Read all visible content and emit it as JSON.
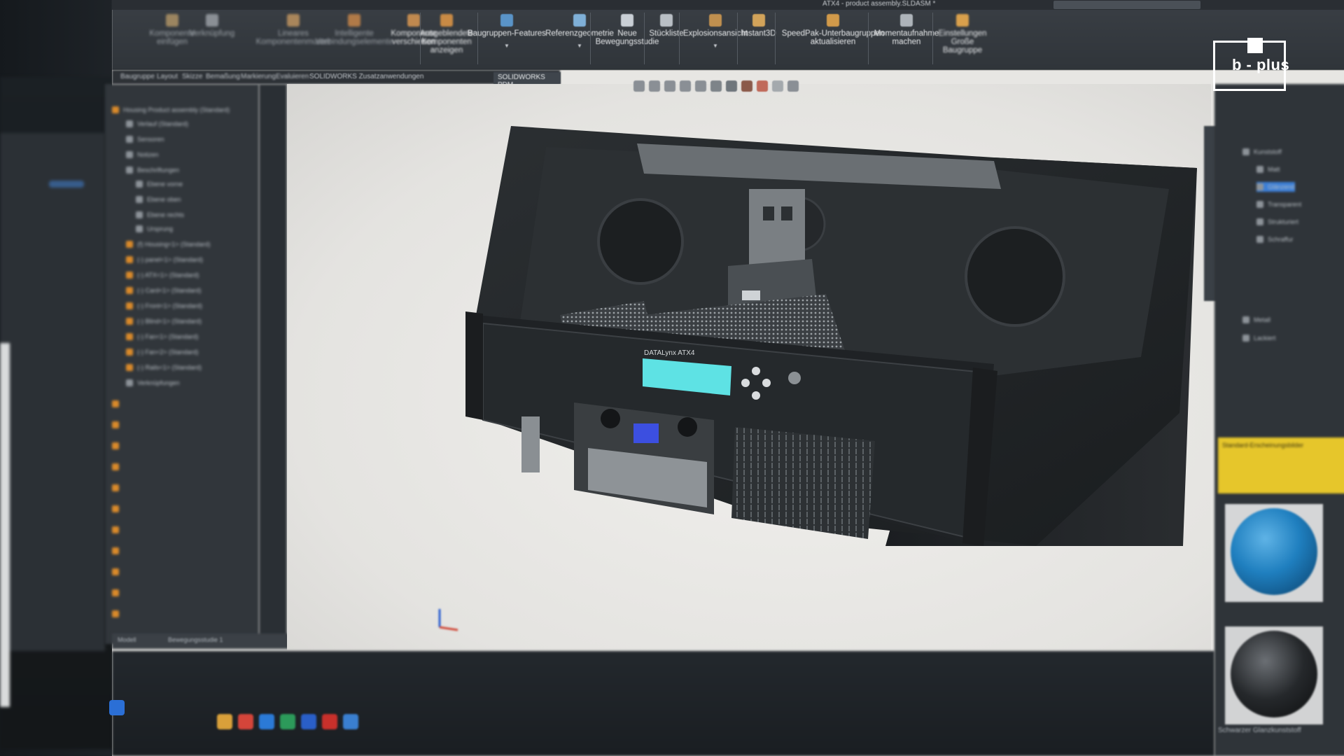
{
  "window": {
    "title": "ATX4 - product assembly.SLDASM *"
  },
  "ribbon": {
    "left_blurred_items": [
      "Komponente einfügen",
      "Verknüpfung",
      "Lineares Komponentenmuster",
      "Intelligente Verbindungselemente",
      "Komponente verschieben",
      "Ausgeblendete Komponenten anzeigen"
    ],
    "items": [
      "Baugruppen-Features",
      "Referenzgeometrie",
      "Neue Bewegungsstudie",
      "Stückliste",
      "Explosionsansicht",
      "Instant3D",
      "SpeedPak-Unterbaugruppen aktualisieren",
      "Momentaufnahme machen",
      "Einstellungen Große Baugruppe"
    ]
  },
  "tabs": [
    "Baugruppe",
    "Layout",
    "Skizze",
    "Bemaßung",
    "Markierung",
    "Evaluieren",
    "SOLIDWORKS Zusatzanwendungen",
    "SOLIDWORKS PDM"
  ],
  "feature_tree": {
    "rows": [
      "Housing Product assembly (Standard)",
      "Verlauf (Standard)",
      "Sensoren",
      "Notizen",
      "Beschriftungen",
      "Ebene vorne",
      "Ebene oben",
      "Ebene rechts",
      "Ursprung",
      "(f) Housing<1> (Standard)",
      "(-) panel<1> (Standard)",
      "(-) ATX<1> (Standard)",
      "(-) Card<1> (Standard)",
      "(-) Front<1> (Standard)",
      "(-) Blind<1> (Standard)",
      "(-) Fan<1> (Standard)",
      "(-) Fan<2> (Standard)",
      "(-) Rails<1> (Standard)",
      "Verknüpfungen"
    ],
    "bottom_tabs": [
      "Modell",
      "Bewegungsstudie 1"
    ]
  },
  "model": {
    "display_label": "DATALynx ATX4"
  },
  "task_pane": {
    "tree_rows": [
      "Kunststoff",
      "Matt",
      "Glänzend",
      "Transparent",
      "Strukturiert",
      "Schraffur",
      "Metall",
      "Lackiert"
    ],
    "note_title": "Standard-Erscheinungsbilder",
    "swatch_label": "Schwarzer Glanzkunststoff"
  },
  "watermark": {
    "text": "b - plus"
  },
  "colors": {
    "ribbon_bg": "#34393e",
    "viewport_bg": "#ececea",
    "lcd": "#5ee2e4",
    "accent_orange": "#d98a2a",
    "note_yellow": "#e6c62b",
    "swatch_blue": "#1f7fbf"
  }
}
